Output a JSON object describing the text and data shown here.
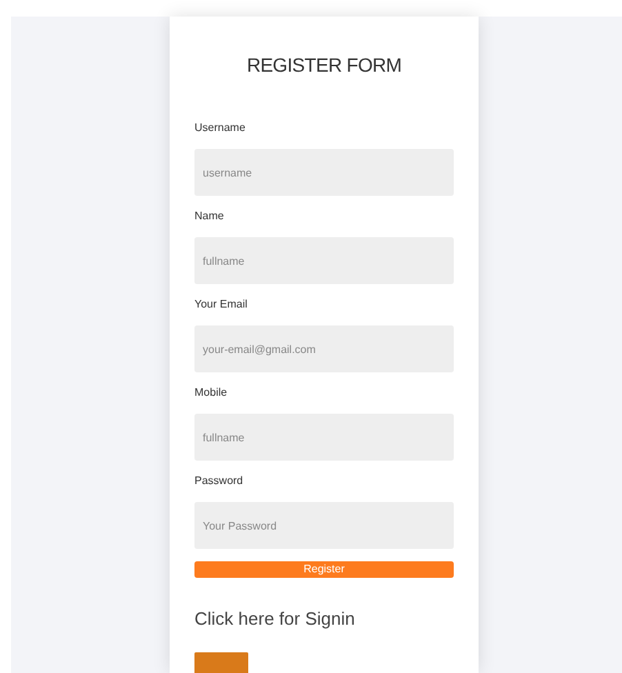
{
  "title": "REGISTER FORM",
  "fields": [
    {
      "label": "Username",
      "placeholder": "username"
    },
    {
      "label": "Name",
      "placeholder": "fullname"
    },
    {
      "label": "Your Email",
      "placeholder": "your-email@gmail.com"
    },
    {
      "label": "Mobile",
      "placeholder": "fullname"
    },
    {
      "label": "Password",
      "placeholder": "Your Password"
    }
  ],
  "submit": "Register",
  "signin_text": "Click here for Signin"
}
